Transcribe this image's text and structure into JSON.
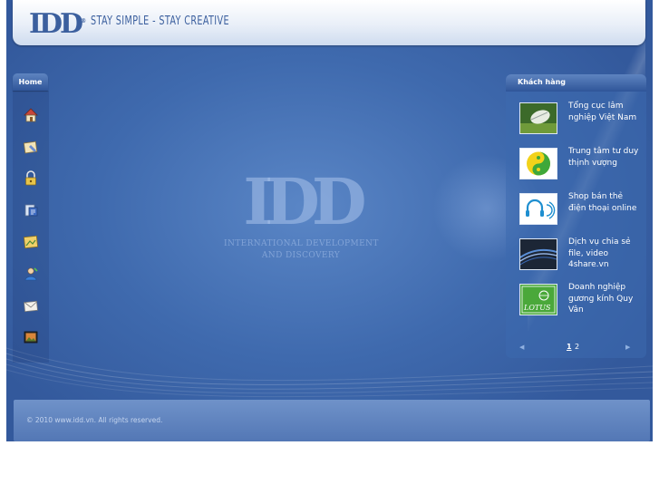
{
  "header": {
    "logo_text": "IDD",
    "logo_mark": "®",
    "slogan": "STAY SIMPLE - STAY CREATIVE"
  },
  "menu": {
    "tab_label": "Home",
    "items": [
      {
        "icon": "home-icon"
      },
      {
        "icon": "info-icon"
      },
      {
        "icon": "lock-icon"
      },
      {
        "icon": "news-icon"
      },
      {
        "icon": "gallery-icon"
      },
      {
        "icon": "user-icon"
      },
      {
        "icon": "mail-icon"
      },
      {
        "icon": "photo-icon"
      }
    ]
  },
  "watermark": {
    "logo_text": "IDD",
    "line1": "INTERNATIONAL DEVELOPMENT",
    "line2": "AND DISCOVERY"
  },
  "clients": {
    "title": "Khách hàng",
    "items": [
      {
        "name": "Tổng cục lâm nghiệp Việt Nam",
        "thumb": "forest-bird-logo"
      },
      {
        "name": "Trung tâm tư duy thịnh vượng",
        "thumb": "yin-yang-logo"
      },
      {
        "name": "Shop bán thẻ điện thoại online",
        "thumb": "headphone-logo"
      },
      {
        "name": "Dịch vụ chia sẻ file, video 4share.vn",
        "thumb": "4share-logo"
      },
      {
        "name": "Doanh nghiệp gương kính Quy Vân",
        "thumb": "lotus-logo"
      }
    ],
    "thumb_lotus_text": "LOTUS",
    "pages": [
      "1",
      "2"
    ],
    "current_page": "1"
  },
  "footer": {
    "copyright": "© 2010 www.idd.vn. All rights reserved."
  },
  "colors": {
    "brand_blue": "#3b5f9e",
    "background": "#3f6aae",
    "tab": "#2f5599"
  }
}
